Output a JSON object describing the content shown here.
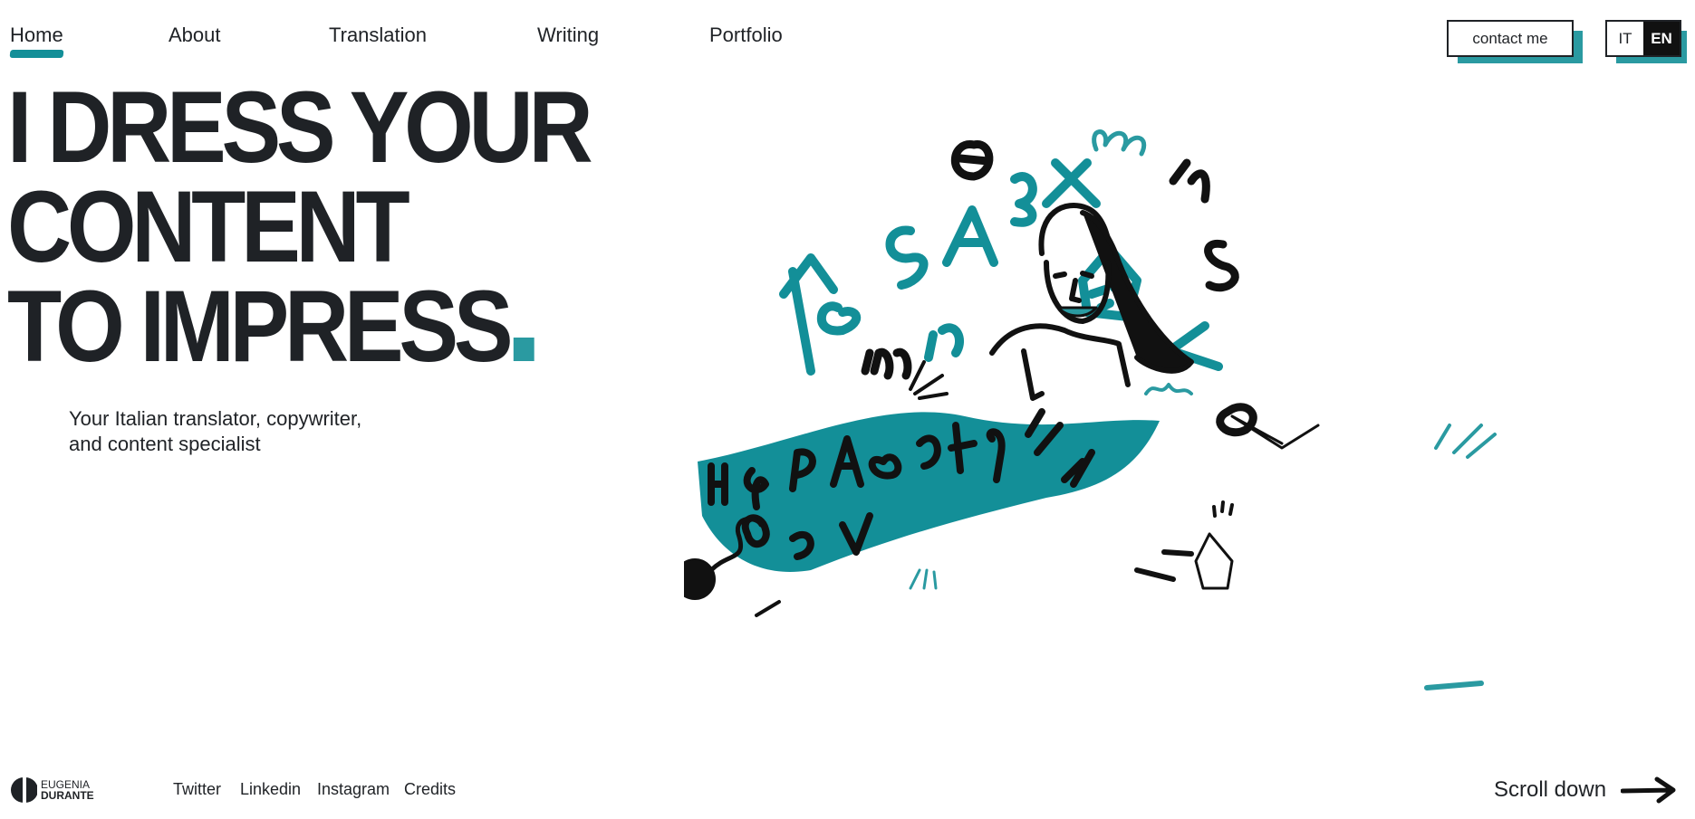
{
  "nav": {
    "items": [
      {
        "label": "Home",
        "active": true
      },
      {
        "label": "About",
        "active": false
      },
      {
        "label": "Translation",
        "active": false
      },
      {
        "label": "Writing",
        "active": false
      },
      {
        "label": "Portfolio",
        "active": false
      }
    ],
    "contact_label": "contact me",
    "languages": [
      {
        "label": "IT",
        "selected": false
      },
      {
        "label": "EN",
        "selected": true
      }
    ]
  },
  "hero": {
    "title_lines": [
      "I DRESS YOUR",
      "CONTENT",
      "TO IMPRESS"
    ],
    "title_end": ".",
    "subtitle_lines": [
      "Your Italian translator, copywriter,",
      "and content specialist"
    ]
  },
  "illustration": {
    "icon": "woman-in-letters-blanket-illustration"
  },
  "footer": {
    "logo_top": "EUGENIA",
    "logo_bottom": "DURANTE",
    "social": [
      "Twitter",
      "Linkedin",
      "Instagram",
      "Credits"
    ],
    "scroll_label": "Scroll down"
  },
  "colors": {
    "accent": "#2a9aa1",
    "text": "#1f2226",
    "background": "#ffffff"
  }
}
